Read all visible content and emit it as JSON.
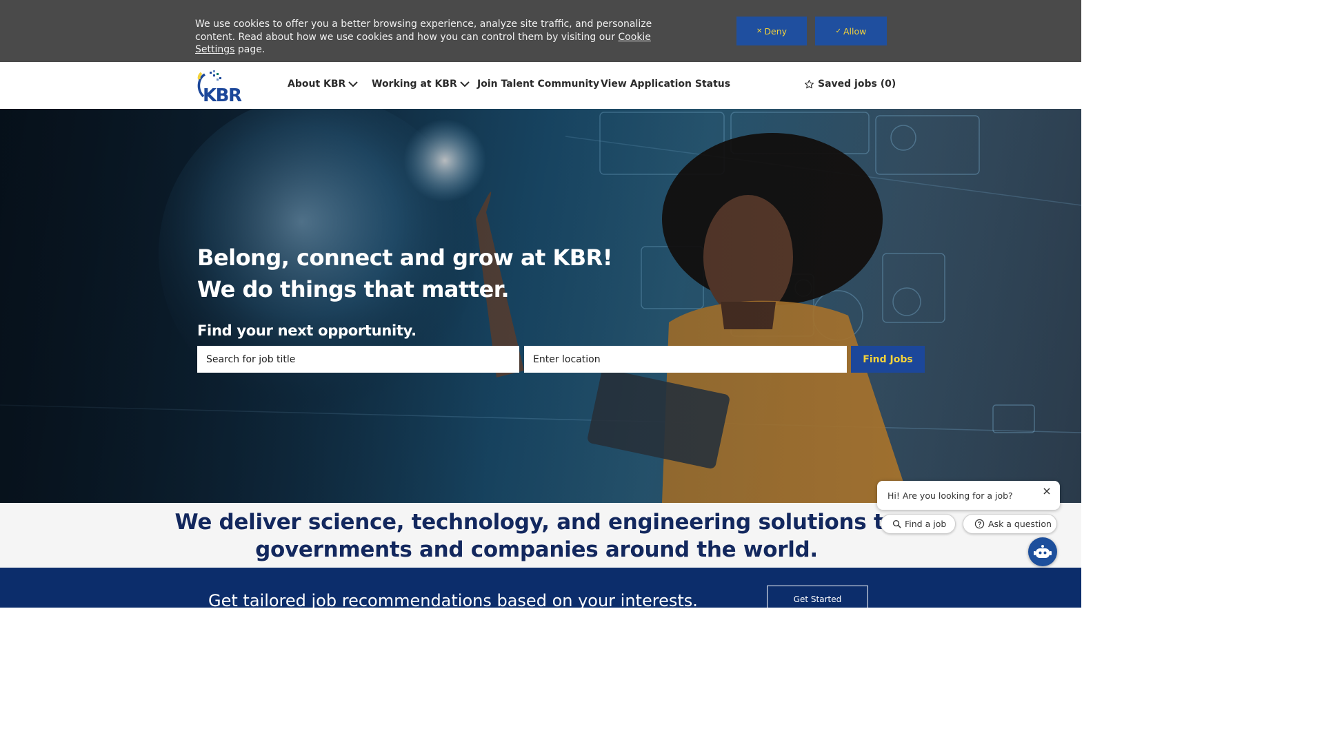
{
  "cookie": {
    "text_before": "We use cookies to offer you a better browsing experience, analyze site traffic, and personalize content. Read about how we use cookies and how you can control them by visiting our ",
    "link": "Cookie Settings",
    "text_after": " page.",
    "deny_label": "Deny",
    "allow_label": "Allow",
    "deny_icon": "close-icon",
    "allow_icon": "check-icon"
  },
  "header": {
    "logo_text": "KBR",
    "nav": {
      "about": "About KBR",
      "working": "Working at KBR",
      "join": "Join Talent Community",
      "status": "View Application Status"
    },
    "saved_jobs": "Saved jobs (0)",
    "saved_icon": "star-icon"
  },
  "hero": {
    "title_line1": "Belong, connect and grow at KBR!",
    "title_line2": "We do things that matter.",
    "subtitle": "Find your next opportunity.",
    "job_placeholder": "Search for job title",
    "location_placeholder": "Enter location",
    "find_button": "Find Jobs"
  },
  "mission": {
    "line1": "We deliver science, technology, and engineering solutions to",
    "line2": "governments and companies around the world."
  },
  "band": {
    "text": "Get tailored job recommendations based on your interests.",
    "button": "Get Started"
  },
  "chat": {
    "message": "Hi! Are you looking for a job?",
    "find_chip": "Find a job",
    "ask_chip": "Ask a question",
    "accent": "#1d4f9c"
  },
  "colors": {
    "brand_blue": "#1c479a",
    "brand_yellow": "#f3d23a",
    "navy": "#13285e",
    "cookie_bg": "#4a4a4a"
  }
}
